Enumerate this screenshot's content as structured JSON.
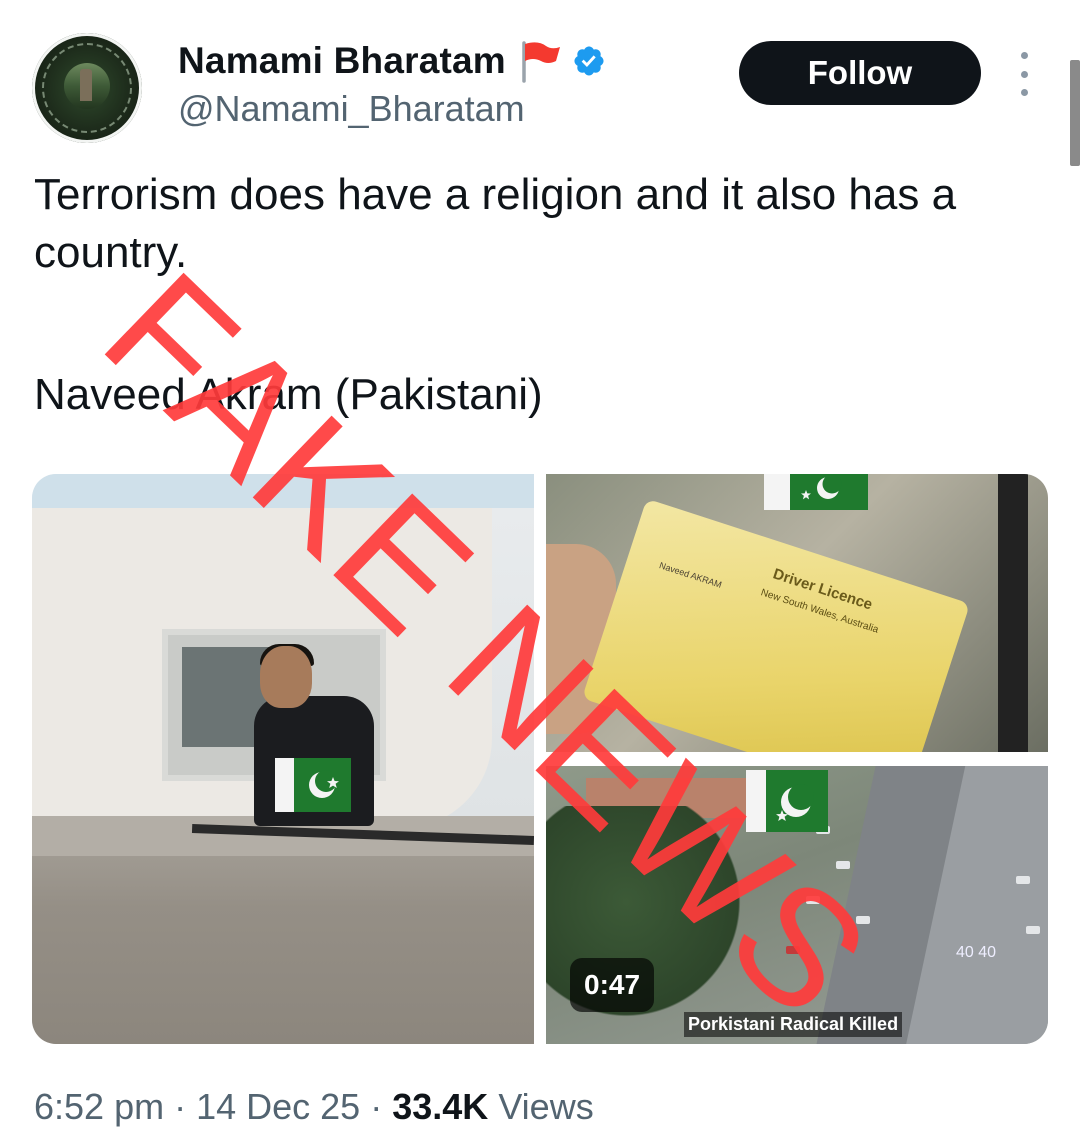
{
  "author": {
    "display_name": "Namami Bharatam",
    "handle": "@Namami_Bharatam",
    "avatar_icon": "circular-logo-avatar",
    "name_emoji_icon": "red-flag-emoji-icon",
    "verified_icon": "verified-badge-icon",
    "verified_color": "#1d9bf0"
  },
  "actions": {
    "follow_label": "Follow",
    "more_icon": "more-vertical-icon"
  },
  "tweet": {
    "line1": "Terrorism does have a religion and it also has a country.",
    "line2": "Naveed Akram (Pakistani)"
  },
  "media": {
    "image1_flag_icon": "pakistan-flag-icon",
    "image2_card_title": "Driver Licence",
    "image2_card_subtitle": "New South Wales, Australia",
    "image2_card_name": "Naveed AKRAM",
    "video_duration": "0:47",
    "video_caption": "Porkistani Radical Killed",
    "video_speed_sign": "40 40"
  },
  "overlay": {
    "stamp_text": "FAKE NEWS",
    "stamp_color": "#ff3b3b"
  },
  "meta": {
    "time": "6:52 pm",
    "date": "14 Dec 25",
    "views_count": "33.4K",
    "views_label": "Views"
  }
}
